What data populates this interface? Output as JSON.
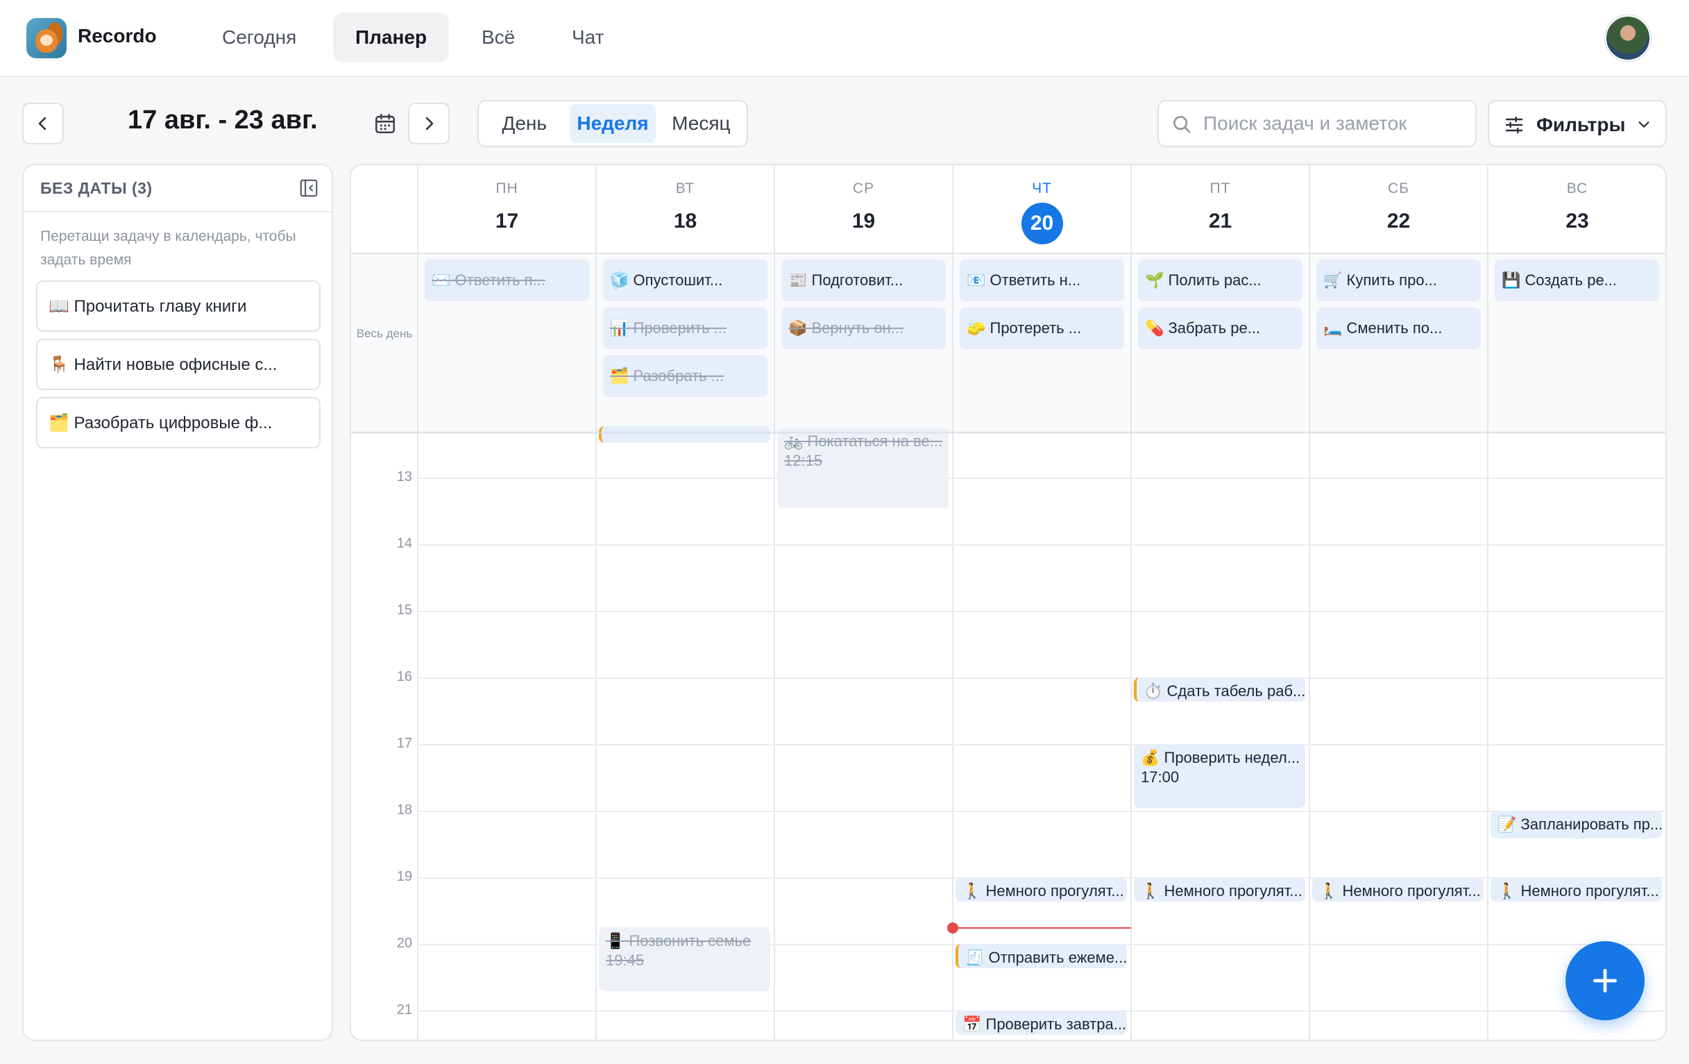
{
  "app": {
    "name": "Recordo"
  },
  "nav": {
    "tabs": [
      {
        "label": "Сегодня",
        "active": false
      },
      {
        "label": "Планер",
        "active": true
      },
      {
        "label": "Всё",
        "active": false
      },
      {
        "label": "Чат",
        "active": false
      }
    ]
  },
  "toolbar": {
    "range": "17 авг. - 23 авг.",
    "views": [
      {
        "label": "День",
        "active": false
      },
      {
        "label": "Неделя",
        "active": true
      },
      {
        "label": "Месяц",
        "active": false
      }
    ],
    "search_placeholder": "Поиск задач и заметок",
    "filters_label": "Фильтры"
  },
  "undated": {
    "title": "БЕЗ ДАТЫ (3)",
    "hint": "Перетащи задачу в календарь, чтобы задать время",
    "items": [
      {
        "label": "📖 Прочитать главу книги"
      },
      {
        "label": "🪑 Найти новые офисные с..."
      },
      {
        "label": "🗂️ Разобрать цифровые ф..."
      }
    ]
  },
  "calendar": {
    "allday_label": "Весь день",
    "days": [
      {
        "dow": "ПН",
        "num": "17",
        "today": false
      },
      {
        "dow": "ВТ",
        "num": "18",
        "today": false
      },
      {
        "dow": "СР",
        "num": "19",
        "today": false
      },
      {
        "dow": "ЧТ",
        "num": "20",
        "today": true
      },
      {
        "dow": "ПТ",
        "num": "21",
        "today": false
      },
      {
        "dow": "СБ",
        "num": "22",
        "today": false
      },
      {
        "dow": "ВС",
        "num": "23",
        "today": false
      }
    ],
    "allday": [
      [
        {
          "label": "✉️ Ответить п...",
          "done": true
        }
      ],
      [
        {
          "label": "🧊 Опустошит...",
          "done": false
        },
        {
          "label": "📊 Проверить ...",
          "done": true
        },
        {
          "label": "🗂️ Разобрать ...",
          "done": true
        }
      ],
      [
        {
          "label": "📰 Подготовит...",
          "done": false
        },
        {
          "label": "📦 Вернуть он...",
          "done": true
        }
      ],
      [
        {
          "label": "📧 Ответить н...",
          "done": false
        },
        {
          "label": "🧽 Протереть ...",
          "done": false
        }
      ],
      [
        {
          "label": "🌱 Полить рас...",
          "done": false
        },
        {
          "label": "💊 Забрать ре...",
          "done": false
        }
      ],
      [
        {
          "label": "🛒 Купить про...",
          "done": false
        },
        {
          "label": "🛏️ Сменить по...",
          "done": false
        }
      ],
      [
        {
          "label": "💾 Создать ре...",
          "done": false
        }
      ]
    ],
    "hours": [
      "13",
      "14",
      "15",
      "16",
      "17",
      "18",
      "19",
      "20",
      "21"
    ],
    "first_hour": 12.35,
    "now_hour": 19.75,
    "now_day": 3,
    "events": [
      {
        "day": 1,
        "start": 12.0,
        "end": 12.35,
        "label": "",
        "time": "",
        "done": false,
        "amber": true
      },
      {
        "day": 2,
        "start": 12.25,
        "end": 13.5,
        "label": "🚲 Покататься на ве...",
        "time": "12:15",
        "done": true,
        "amber": false
      },
      {
        "day": 4,
        "start": 16.0,
        "end": 16.4,
        "label": "⏱️ Сдать табель раб...",
        "time": "",
        "done": false,
        "amber": true
      },
      {
        "day": 4,
        "start": 17.0,
        "end": 18.0,
        "label": "💰 Проверить недел...",
        "time": "17:00",
        "done": false,
        "amber": false
      },
      {
        "day": 6,
        "start": 18.0,
        "end": 18.45,
        "label": "📝 Запланировать пр...",
        "time": "",
        "done": false,
        "amber": false
      },
      {
        "day": 3,
        "start": 19.0,
        "end": 19.4,
        "label": "🚶 Немного прогулят...",
        "time": "",
        "done": false,
        "amber": false
      },
      {
        "day": 4,
        "start": 19.0,
        "end": 19.4,
        "label": "🚶 Немного прогулят...",
        "time": "",
        "done": false,
        "amber": false
      },
      {
        "day": 5,
        "start": 19.0,
        "end": 19.4,
        "label": "🚶 Немного прогулят...",
        "time": "",
        "done": false,
        "amber": false
      },
      {
        "day": 6,
        "start": 19.0,
        "end": 19.4,
        "label": "🚶 Немного прогулят...",
        "time": "",
        "done": false,
        "amber": false
      },
      {
        "day": 1,
        "start": 19.75,
        "end": 20.75,
        "label": "📱 Позвонить семье",
        "time": "19:45",
        "done": true,
        "amber": false
      },
      {
        "day": 3,
        "start": 20.0,
        "end": 20.4,
        "label": "🧾 Отправить ежеме...",
        "time": "",
        "done": false,
        "amber": true
      },
      {
        "day": 3,
        "start": 21.0,
        "end": 21.4,
        "label": "📅 Проверить завтра...",
        "time": "",
        "done": false,
        "amber": false
      }
    ]
  },
  "colors": {
    "accent": "#1677e6",
    "now": "#e5484d",
    "chip": "#e5eefa",
    "amber": "#f5a623"
  },
  "icons": [
    "back-chevron-icon",
    "forward-chevron-icon",
    "calendar-icon",
    "search-icon",
    "sliders-icon",
    "chevron-down-icon",
    "collapse-panel-icon",
    "plus-icon"
  ]
}
